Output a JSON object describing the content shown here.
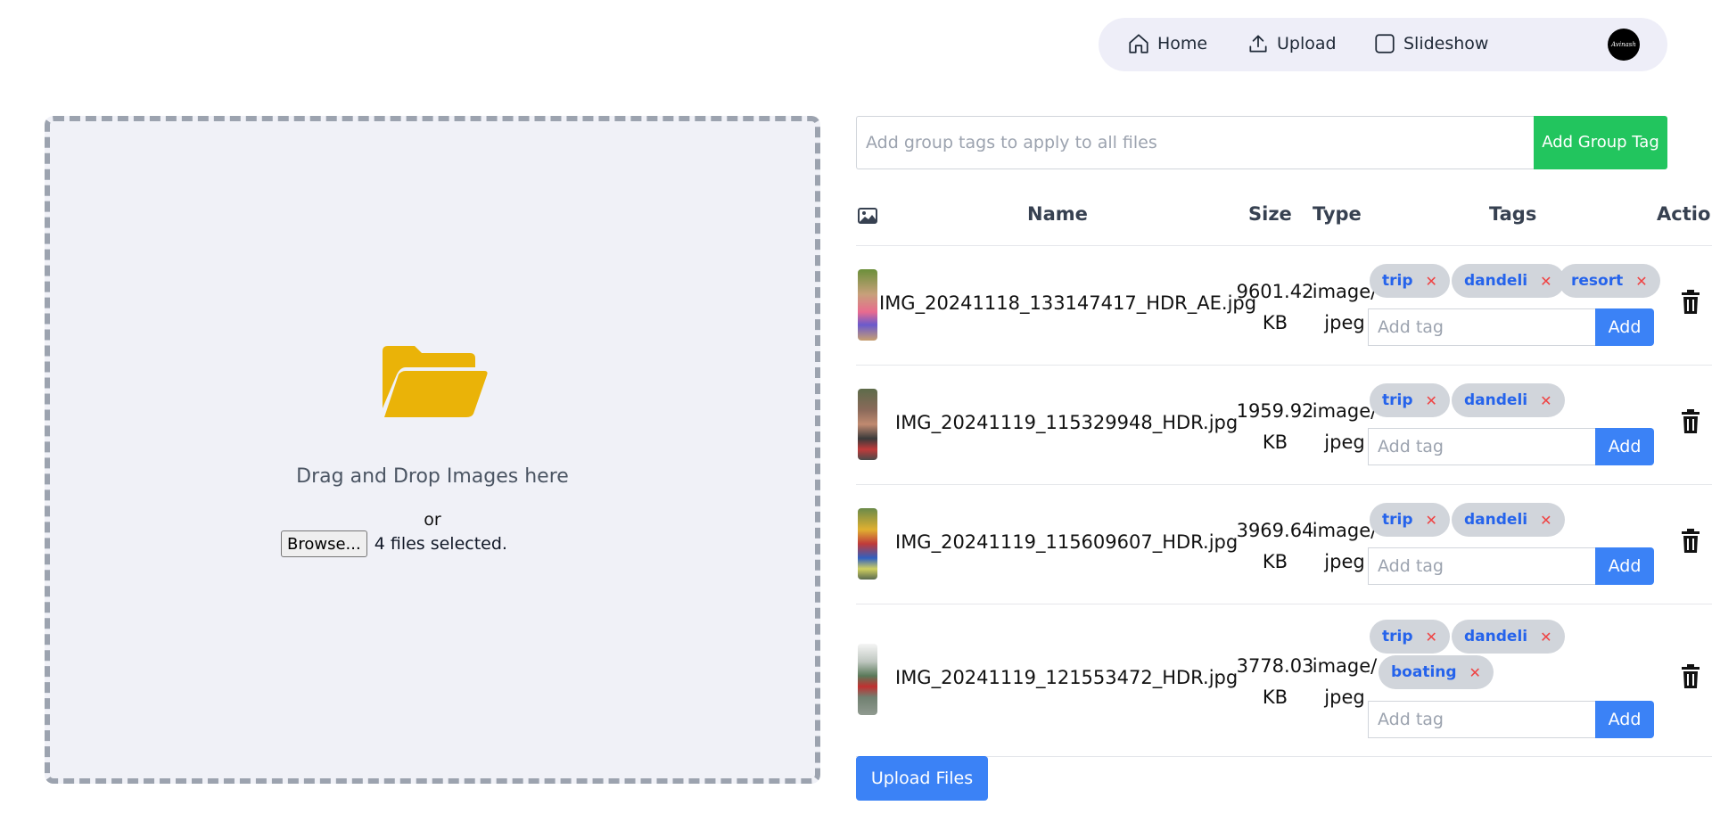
{
  "nav": {
    "home": "Home",
    "upload": "Upload",
    "slideshow": "Slideshow",
    "avatar_text": "Avinash"
  },
  "dropzone": {
    "drag_text": "Drag and Drop Images here",
    "or_text": "or",
    "browse_label": "Browse...",
    "files_selected": "4 files selected."
  },
  "group_tag": {
    "placeholder": "Add group tags to apply to all files",
    "button_label": "Add Group Tag"
  },
  "table": {
    "headers": {
      "name": "Name",
      "size": "Size",
      "type": "Type",
      "tags": "Tags",
      "action": "Action"
    },
    "tag_placeholder": "Add tag",
    "add_label": "Add",
    "rows": [
      {
        "name": "IMG_20241118_133147417_HDR_AE.jpg",
        "size": "9601.42",
        "size_unit": "KB",
        "type_a": "image/",
        "type_b": "jpeg",
        "tags": [
          "trip",
          "dandeli",
          "resort"
        ]
      },
      {
        "name": "IMG_20241119_115329948_HDR.jpg",
        "size": "1959.92",
        "size_unit": "KB",
        "type_a": "image/",
        "type_b": "jpeg",
        "tags": [
          "trip",
          "dandeli"
        ]
      },
      {
        "name": "IMG_20241119_115609607_HDR.jpg",
        "size": "3969.64",
        "size_unit": "KB",
        "type_a": "image/",
        "type_b": "jpeg",
        "tags": [
          "trip",
          "dandeli"
        ]
      },
      {
        "name": "IMG_20241119_121553472_HDR.jpg",
        "size": "3778.03",
        "size_unit": "KB",
        "type_a": "image/",
        "type_b": "jpeg",
        "tags": [
          "trip",
          "dandeli",
          "boating"
        ]
      }
    ]
  },
  "upload_button": "Upload Files",
  "colors": {
    "accent": "#3b82f6",
    "green": "#22c55e",
    "folder": "#eab308",
    "tag_bg": "#d1d5db",
    "tag_text": "#2563eb",
    "remove": "#ef4444"
  }
}
